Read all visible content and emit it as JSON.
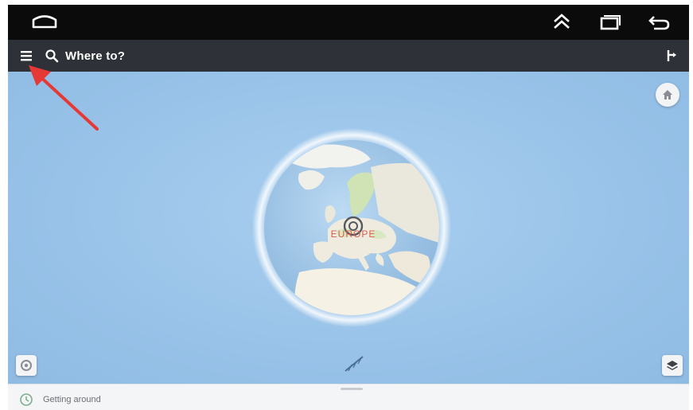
{
  "system_bar": {
    "icons": [
      "home-icon",
      "chevron-up-icon",
      "recents-icon",
      "back-icon"
    ]
  },
  "app_bar": {
    "menu_icon": "hamburger-menu-icon",
    "search_icon": "search-icon",
    "search_text": "Where to?",
    "route_icon": "route-icon"
  },
  "map": {
    "globe_label": "EUROPE",
    "home_icon": "home-icon",
    "compass_icon": "compass-icon",
    "layers_icon": "layers-icon"
  },
  "bottom_sheet": {
    "icon": "clock-icon",
    "label": "Getting around"
  },
  "colors": {
    "system_bar": "#0b0b0b",
    "app_bar": "#2e3138",
    "map_water": "#9cc6ea",
    "land": "#f2efe4",
    "land_green": "#cfe3b5",
    "annotation": "#e53935",
    "globe_label": "#e35a4b"
  }
}
